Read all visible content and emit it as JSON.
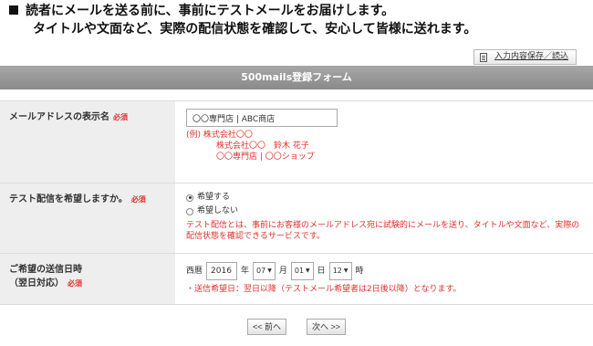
{
  "intro": {
    "line1": "読者にメールを送る前に、事前にテストメールをお届けします。",
    "line2": "タイトルや文面など、実際の配信状態を確認して、安心して皆様に送れます。"
  },
  "save_link": {
    "label": "入力内容保存／読込",
    "icon": "document-icon"
  },
  "form_title": "500mails登録フォーム",
  "required_badge": "必須",
  "display_name": {
    "label": "メールアドレスの表示名",
    "value": "〇〇専門店 | ABC商店",
    "example_prefix": "(例)",
    "examples": [
      "株式会社〇〇",
      "株式会社〇〇　鈴木 花子",
      "〇〇専門店 | 〇〇ショップ"
    ]
  },
  "test_delivery": {
    "label": "テスト配信を希望しますか。",
    "options": [
      {
        "label": "希望する",
        "checked": true
      },
      {
        "label": "希望しない",
        "checked": false
      }
    ],
    "note": "テスト配信とは、事前にお客様のメールアドレス宛に試験的にメールを送り、タイトルや文面など、実際の配信状態を確認できるサービスです。"
  },
  "send_date": {
    "label_line1": "ご希望の送信日時",
    "label_line2": "（翌日対応）",
    "era": "西暦",
    "year": "2016",
    "year_unit": "年",
    "month": "07",
    "month_unit": "月",
    "day": "01",
    "day_unit": "日",
    "hour": "12",
    "hour_unit": "時",
    "note": "・送信希望日：翌日以降（テストメール希望者は2日後以降）となります。"
  },
  "nav": {
    "prev": "<< 前へ",
    "next": "次へ >>"
  },
  "colors": {
    "required": "#e0312d",
    "header_bg": "#999999",
    "label_bg": "#eeeeee"
  }
}
